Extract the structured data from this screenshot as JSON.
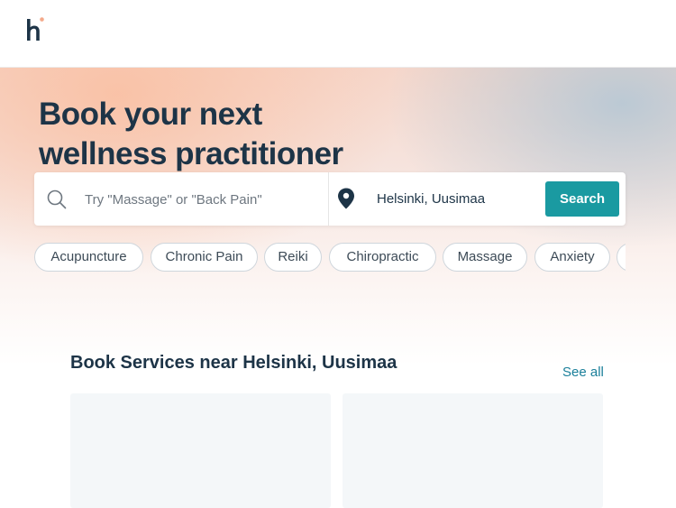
{
  "header": {
    "logo_icon": "h-logo-icon",
    "brand_colors": {
      "navy": "#1d3447",
      "accent": "#f4a98a"
    }
  },
  "hero": {
    "headline_line1": "Book your next",
    "headline_line2": "wellness practitioner"
  },
  "search": {
    "placeholder": "Try \"Massage\" or \"Back Pain\"",
    "search_icon": "search-icon",
    "location_icon": "location-pin-icon",
    "location": "Helsinki, Uusimaa",
    "button_label": "Search",
    "button_color": "#1a9aa1"
  },
  "chips": [
    {
      "label": "Acupuncture"
    },
    {
      "label": "Chronic Pain"
    },
    {
      "label": "Reiki"
    },
    {
      "label": "Chiropractic"
    },
    {
      "label": "Massage"
    },
    {
      "label": "Anxiety"
    },
    {
      "label": ""
    }
  ],
  "services": {
    "title": "Book Services near Helsinki, Uusimaa",
    "see_all": "See all"
  }
}
